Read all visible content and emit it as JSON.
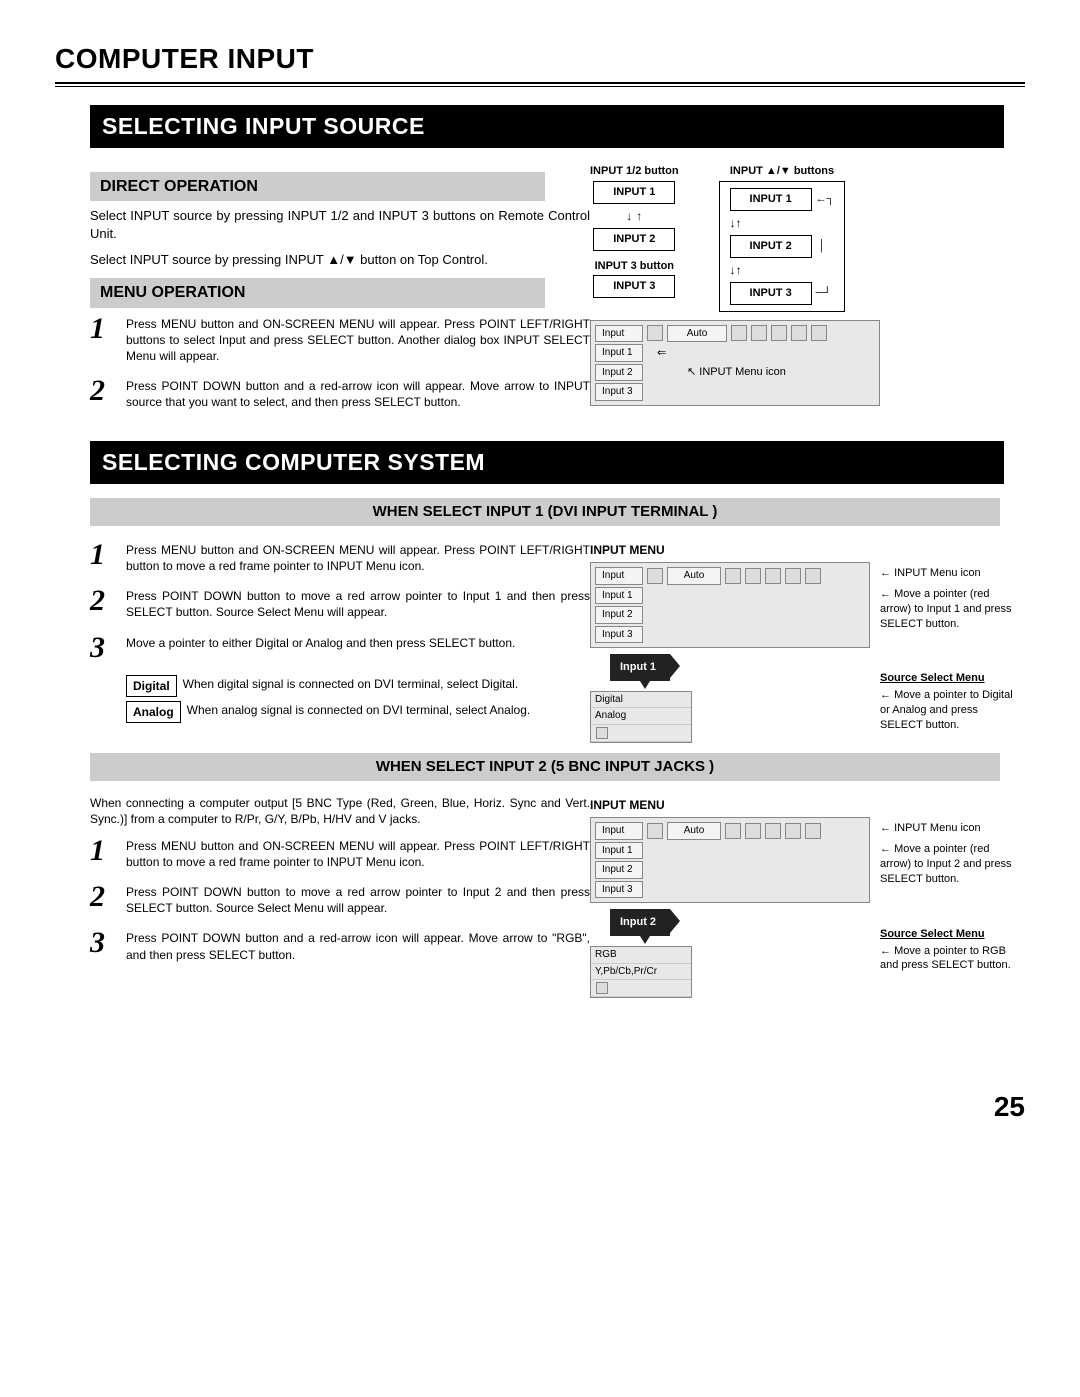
{
  "page_title": "COMPUTER INPUT",
  "page_number": "25",
  "section1": {
    "bar": "SELECTING INPUT SOURCE",
    "sub1": "DIRECT OPERATION",
    "para1": "Select INPUT source by pressing INPUT 1/2 and INPUT 3 buttons on Remote Control Unit.",
    "para2": "Select INPUT source by pressing INPUT ▲/▼ button on Top Control.",
    "sub2": "MENU OPERATION",
    "step1": "Press MENU button and ON-SCREEN MENU will appear.  Press POINT LEFT/RIGHT buttons to select Input and press SELECT button.  Another dialog box INPUT SELECT Menu will appear.",
    "step2": "Press POINT DOWN button and a red-arrow icon will appear. Move arrow to INPUT source that you want to select, and then press SELECT button.",
    "diag": {
      "label_12": "INPUT 1/2 button",
      "label_ud": "INPUT ▲/▼  buttons",
      "label_3": "INPUT 3 button",
      "in1": "INPUT 1",
      "in2": "INPUT 2",
      "in3": "INPUT 3"
    },
    "osd": {
      "title": "Input",
      "auto": "Auto",
      "i1": "Input 1",
      "i2": "Input 2",
      "i3": "Input 3",
      "note": "INPUT Menu icon"
    }
  },
  "section2": {
    "bar": "SELECTING COMPUTER SYSTEM",
    "sub1": "WHEN SELECT  INPUT 1 (DVI INPUT TERMINAL )",
    "step1": "Press MENU button and ON-SCREEN MENU will appear.  Press POINT LEFT/RIGHT button to move a red frame pointer to INPUT Menu icon.",
    "step2": "Press POINT DOWN button to move a red arrow pointer to Input 1 and then press SELECT button.  Source Select Menu will appear.",
    "step3": "Move a pointer to either Digital or Analog and then press SELECT button.",
    "digital_label": "Digital",
    "digital_text": "When digital signal is connected on DVI terminal, select Digital.",
    "analog_label": "Analog",
    "analog_text": "When analog signal is connected on DVI terminal, select Analog.",
    "osd": {
      "title_label": "INPUT MENU",
      "title": "Input",
      "auto": "Auto",
      "i1": "Input 1",
      "i2": "Input 2",
      "i3": "Input 3",
      "note1": "INPUT Menu icon",
      "note2": "Move a pointer (red arrow) to Input 1 and press SELECT button.",
      "tag": "Input 1",
      "src_title": "Source Select Menu",
      "src_note": "Move a pointer to Digital or Analog and press SELECT button.",
      "src_digital": "Digital",
      "src_analog": "Analog"
    },
    "sub2": "WHEN SELECT INPUT 2 (5 BNC INPUT JACKS )",
    "intro2": "When connecting a computer output [5 BNC Type (Red, Green, Blue, Horiz. Sync and Vert. Sync.)] from a computer to R/Pr, G/Y, B/Pb, H/HV and V jacks.",
    "b_step1": "Press MENU button and ON-SCREEN MENU will appear.  Press POINT LEFT/RIGHT button to move a red frame pointer to INPUT Menu icon.",
    "b_step2": "Press POINT DOWN button to move a red arrow pointer to Input 2 and then press SELECT button.  Source Select Menu will appear.",
    "b_step3": "Press POINT DOWN button and a red-arrow icon will appear. Move arrow to \"RGB\", and then press SELECT button.",
    "osd2": {
      "title_label": "INPUT MENU",
      "title": "Input",
      "auto": "Auto",
      "i1": "Input 1",
      "i2": "Input 2",
      "i3": "Input 3",
      "note1": "INPUT Menu icon",
      "note2": "Move a pointer (red arrow) to Input 2 and press SELECT button.",
      "tag": "Input 2",
      "src_title": "Source Select Menu",
      "src_note": "Move a pointer to RGB and press SELECT button.",
      "src_rgb": "RGB",
      "src_ypbpr": "Y,Pb/Cb,Pr/Cr"
    }
  }
}
